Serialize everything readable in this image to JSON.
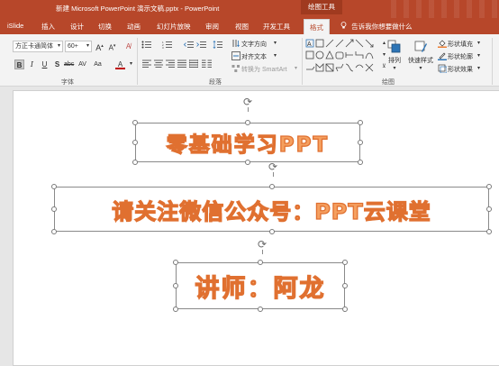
{
  "window": {
    "doc_title": "新建 Microsoft PowerPoint 演示文稿.pptx  -  PowerPoint",
    "context_tab_group": "绘图工具"
  },
  "tabs": [
    {
      "label": "iSlide",
      "active": false
    },
    {
      "label": "插入",
      "active": false
    },
    {
      "label": "设计",
      "active": false
    },
    {
      "label": "切换",
      "active": false
    },
    {
      "label": "动画",
      "active": false
    },
    {
      "label": "幻灯片放映",
      "active": false
    },
    {
      "label": "审阅",
      "active": false
    },
    {
      "label": "视图",
      "active": false
    },
    {
      "label": "开发工具",
      "active": false
    },
    {
      "label": "格式",
      "active": true
    }
  ],
  "tell_me": "告诉我你想要做什么",
  "ribbon": {
    "font": {
      "font_name": "方正卡通简体",
      "font_size": "60+",
      "group_label": "字体"
    },
    "paragraph": {
      "text_direction": "文字方向",
      "align_text": "对齐文本",
      "convert_smartart": "转换为 SmartArt",
      "group_label": "段落"
    },
    "drawing": {
      "arrange": "排列",
      "quick_styles": "快速样式",
      "shape_fill": "形状填充",
      "shape_outline": "形状轮廓",
      "shape_effects": "形状效果",
      "group_label": "绘图"
    }
  },
  "slide": {
    "textboxes": [
      {
        "text": "零基础学习PPT"
      },
      {
        "text": "请关注微信公众号：PPT云课堂"
      },
      {
        "text": "讲师：阿龙"
      }
    ],
    "text_color": "#f5a060",
    "text_outline_color": "#e07030"
  },
  "colors": {
    "accent": "#b7472a"
  }
}
